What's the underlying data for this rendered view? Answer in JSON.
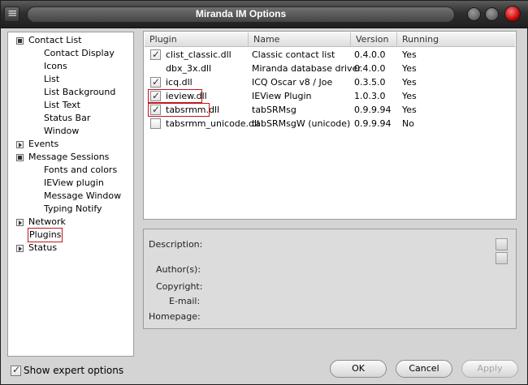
{
  "window": {
    "title": "Miranda IM Options"
  },
  "tree": {
    "items": [
      {
        "label": "Contact List",
        "level": 0,
        "expander": "open"
      },
      {
        "label": "Contact Display",
        "level": 1
      },
      {
        "label": "Icons",
        "level": 1
      },
      {
        "label": "List",
        "level": 1
      },
      {
        "label": "List Background",
        "level": 1
      },
      {
        "label": "List Text",
        "level": 1
      },
      {
        "label": "Status Bar",
        "level": 1
      },
      {
        "label": "Window",
        "level": 1
      },
      {
        "label": "Events",
        "level": 0,
        "expander": "closed"
      },
      {
        "label": "Message Sessions",
        "level": 0,
        "expander": "open"
      },
      {
        "label": "Fonts and colors",
        "level": 1
      },
      {
        "label": "IEView plugin",
        "level": 1
      },
      {
        "label": "Message Window",
        "level": 1
      },
      {
        "label": "Typing Notify",
        "level": 1
      },
      {
        "label": "Network",
        "level": 0,
        "expander": "closed"
      },
      {
        "label": "Plugins",
        "level": 0,
        "selected": true
      },
      {
        "label": "Status",
        "level": 0,
        "expander": "closed"
      }
    ]
  },
  "plugins": {
    "columns": [
      "Plugin",
      "Name",
      "Version",
      "Running"
    ],
    "rows": [
      {
        "checked": true,
        "file": "clist_classic.dll",
        "name": "Classic contact list",
        "version": "0.4.0.0",
        "running": "Yes",
        "highlight": false,
        "checkbox": true
      },
      {
        "checked": false,
        "file": "dbx_3x.dll",
        "name": "Miranda database driver",
        "version": "0.4.0.0",
        "running": "Yes",
        "highlight": false,
        "checkbox": false
      },
      {
        "checked": true,
        "file": "icq.dll",
        "name": "ICQ Oscar v8 / Joe",
        "version": "0.3.5.0",
        "running": "Yes",
        "highlight": false,
        "checkbox": true
      },
      {
        "checked": true,
        "file": "ieview.dll",
        "name": "IEView Plugin",
        "version": "1.0.3.0",
        "running": "Yes",
        "highlight": true,
        "checkbox": true
      },
      {
        "checked": true,
        "file": "tabsrmm.dll",
        "name": "tabSRMsg",
        "version": "0.9.9.94",
        "running": "Yes",
        "highlight": true,
        "checkbox": true
      },
      {
        "checked": false,
        "file": "tabsrmm_unicode.dll",
        "name": "tabSRMsgW (unicode)",
        "version": "0.9.9.94",
        "running": "No",
        "highlight": false,
        "checkbox": true
      }
    ]
  },
  "details": {
    "description_label": "Description:",
    "authors_label": "Author(s):",
    "copyright_label": "Copyright:",
    "email_label": "E-mail:",
    "homepage_label": "Homepage:"
  },
  "footer": {
    "expert_label": "Show expert options",
    "expert_checked": true,
    "ok_label": "OK",
    "cancel_label": "Cancel",
    "apply_label": "Apply"
  },
  "colors": {
    "highlight_border": "#c0161c",
    "close_button": "#c00000"
  }
}
